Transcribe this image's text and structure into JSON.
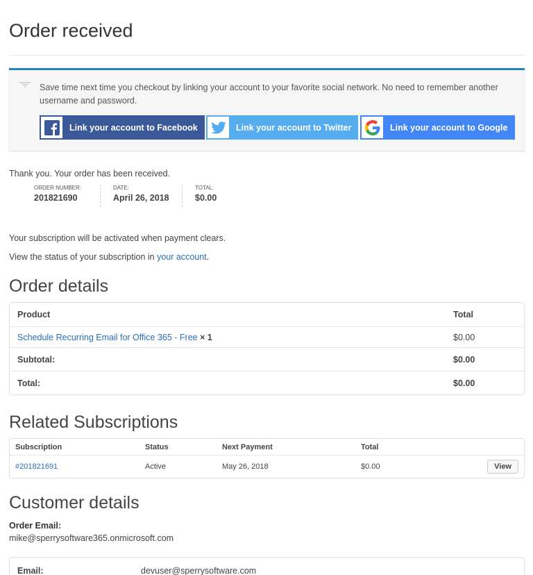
{
  "page": {
    "title": "Order received"
  },
  "social": {
    "message": "Save time next time you checkout by linking your account to your favorite social network. No need to remember another username and password.",
    "facebook_label": "Link your account to Facebook",
    "twitter_label": "Link your account to Twitter",
    "google_label": "Link your account to Google",
    "colors": {
      "facebook": "#3b5998",
      "twitter": "#55acee",
      "google": "#4285f4",
      "accent": "#1e85be"
    }
  },
  "order": {
    "thanks": "Thank you. Your order has been received.",
    "overview": [
      {
        "label": "ORDER NUMBER:",
        "value": "201821690"
      },
      {
        "label": "DATE:",
        "value": "April 26, 2018"
      },
      {
        "label": "TOTAL:",
        "value": "$0.00"
      }
    ],
    "subscription_note": "Your subscription will be activated when payment clears.",
    "status_prefix": "View the status of your subscription in ",
    "status_link": "your account",
    "status_suffix": "."
  },
  "order_details": {
    "heading": "Order details",
    "headers": {
      "product": "Product",
      "total": "Total"
    },
    "item": {
      "name": "Schedule Recurring Email for Office 365 - Free",
      "qty": "× 1",
      "total": "$0.00"
    },
    "subtotal": {
      "label": "Subtotal:",
      "value": "$0.00"
    },
    "total": {
      "label": "Total:",
      "value": "$0.00"
    }
  },
  "related": {
    "heading": "Related Subscriptions",
    "headers": {
      "subscription": "Subscription",
      "status": "Status",
      "next_payment": "Next Payment",
      "total": "Total"
    },
    "row": {
      "id": "#201821691",
      "status": "Active",
      "next_payment": "May 26, 2018",
      "total": "$0.00",
      "action": "View"
    }
  },
  "customer": {
    "heading": "Customer details",
    "order_email_label": "Order Email:",
    "order_email": "mike@sperrysoftware365.onmicrosoft.com",
    "email_label": "Email:",
    "email": "devuser@sperrysoftware.com"
  }
}
